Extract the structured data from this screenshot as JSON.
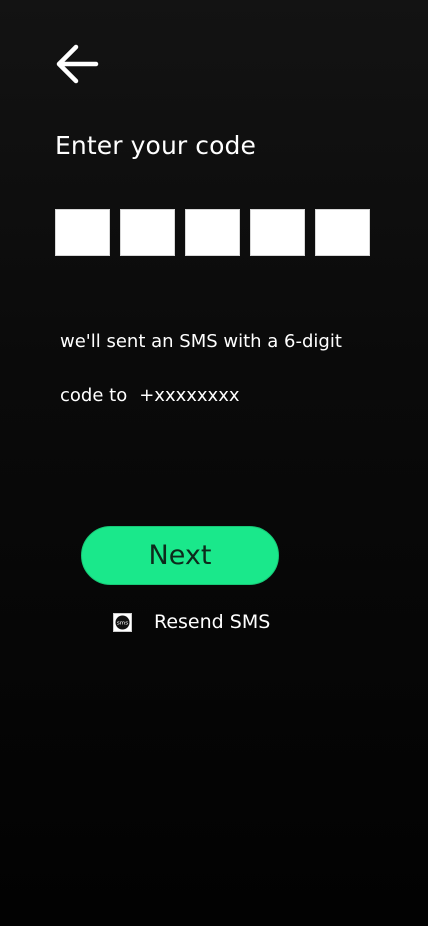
{
  "header": {
    "back_icon": "arrow-left-icon"
  },
  "title": "Enter your code",
  "code_input": {
    "digits": [
      "",
      "",
      "",
      "",
      ""
    ]
  },
  "info": {
    "line1": "we'll sent an SMS with a 6-digit",
    "line2_prefix": "code to",
    "phone": "+xxxxxxxx"
  },
  "actions": {
    "next_label": "Next",
    "resend_label": "Resend SMS",
    "resend_icon": "sms-icon",
    "sms_icon_text": "sms"
  },
  "colors": {
    "background": "#0a0a0a",
    "accent": "#1ae88b",
    "text": "#ffffff"
  }
}
